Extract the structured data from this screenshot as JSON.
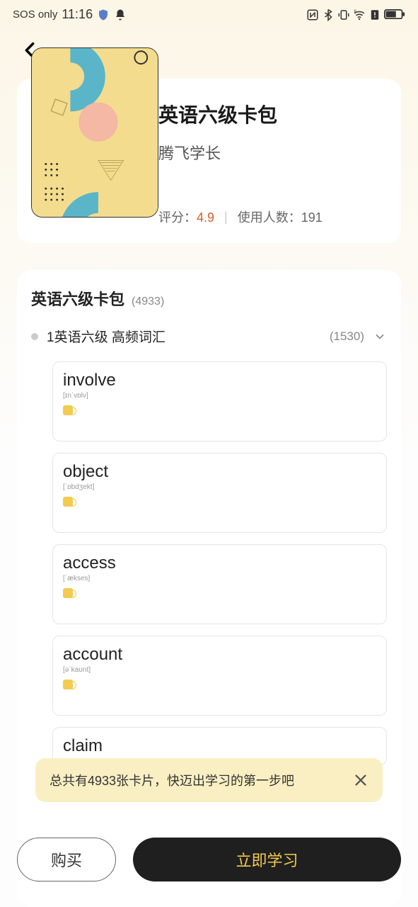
{
  "status": {
    "carrier": "SOS only",
    "time": "11:16"
  },
  "deck": {
    "title": "英语六级卡包",
    "author": "腾飞学长",
    "rating_label": "评分：",
    "rating": "4.9",
    "users_label": "使用人数：",
    "users": "191"
  },
  "section": {
    "title": "英语六级卡包",
    "count": "(4933)"
  },
  "group": {
    "title": "1英语六级 高频词汇",
    "count": "(1530)"
  },
  "words": [
    {
      "word": "involve",
      "phonetic": "[ɪnˈvɒlv]"
    },
    {
      "word": "object",
      "phonetic": "[ˈɒbdʒekt]"
    },
    {
      "word": "access",
      "phonetic": "[ˈækses]"
    },
    {
      "word": "account",
      "phonetic": "[əˈkaʊnt]"
    },
    {
      "word": "claim",
      "phonetic": ""
    }
  ],
  "toast": {
    "text": "总共有4933张卡片，快迈出学习的第一步吧"
  },
  "buttons": {
    "buy": "购买",
    "study": "立即学习"
  }
}
